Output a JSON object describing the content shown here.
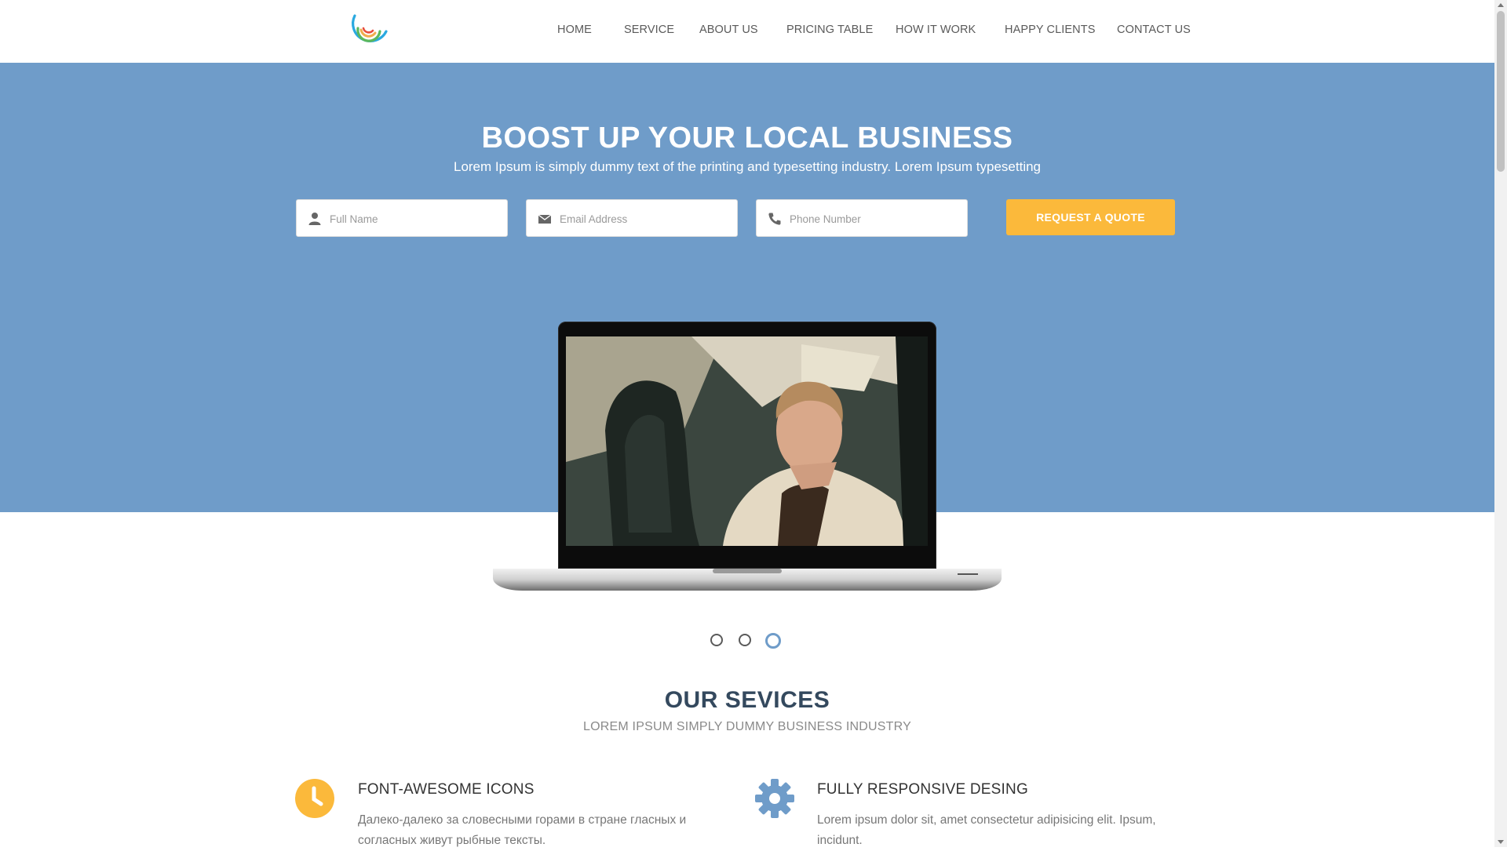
{
  "nav": {
    "items": [
      {
        "label": "HOME"
      },
      {
        "label": "SERVICE"
      },
      {
        "label": "ABOUT US"
      },
      {
        "label": "PRICING TABLE"
      },
      {
        "label": "HOW IT WORK"
      },
      {
        "label": "HAPPY CLIENTS"
      },
      {
        "label": "CONTACT US"
      }
    ]
  },
  "hero": {
    "title": "BOOST UP YOUR LOCAL BUSINESS",
    "subtitle": "Lorem Ipsum is simply dummy text of the printing and typesetting industry. Lorem Ipsum typesetting",
    "form": {
      "name_placeholder": "Full Name",
      "email_placeholder": "Email Address",
      "phone_placeholder": "Phone Number",
      "submit_label": "REQUEST A QUOTE"
    }
  },
  "carousel": {
    "slide_count": 3,
    "active_index": 2
  },
  "services": {
    "title": "OUR SEVICES",
    "subtitle": "LOREM IPSUM SIMPLY DUMMY BUSINESS INDUSTRY",
    "items": [
      {
        "icon": "clock-icon",
        "title": "FONT-AWESOME ICONS",
        "text": "Далеко-далеко за словесными горами в стране гласных и согласных живут рыбные тексты."
      },
      {
        "icon": "gear-icon",
        "title": "FULLY RESPONSIVE DESING",
        "text": "Lorem ipsum dolor sit, amet consectetur adipisicing elit. Ipsum, incidunt."
      }
    ]
  },
  "colors": {
    "hero_bg": "#6f9cc9",
    "accent": "#fbb93b",
    "heading": "#34495e"
  }
}
